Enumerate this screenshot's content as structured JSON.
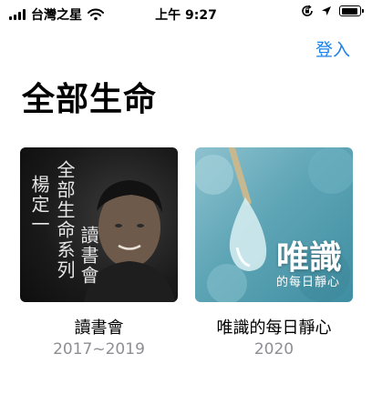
{
  "status_bar": {
    "carrier": "台灣之星",
    "time": "上午 9:27",
    "icons": [
      "signal-bars",
      "wifi",
      "orientation-lock",
      "location",
      "battery"
    ],
    "battery_level": 0.85
  },
  "header": {
    "login_label": "登入"
  },
  "page": {
    "title": "全部生命"
  },
  "cards": [
    {
      "title": "讀書會",
      "year": "2017~2019",
      "cover": {
        "author_vertical": "楊定一",
        "subtitle_vertical": "全部生命系列",
        "series_vertical": "讀書會"
      }
    },
    {
      "title": "唯識的每日靜心",
      "year": "2020",
      "cover": {
        "overlay_title": "唯識",
        "overlay_subtitle": "的每日靜心"
      }
    }
  ],
  "colors": {
    "accent": "#1a82ea",
    "secondary_text": "#8e8e93"
  }
}
